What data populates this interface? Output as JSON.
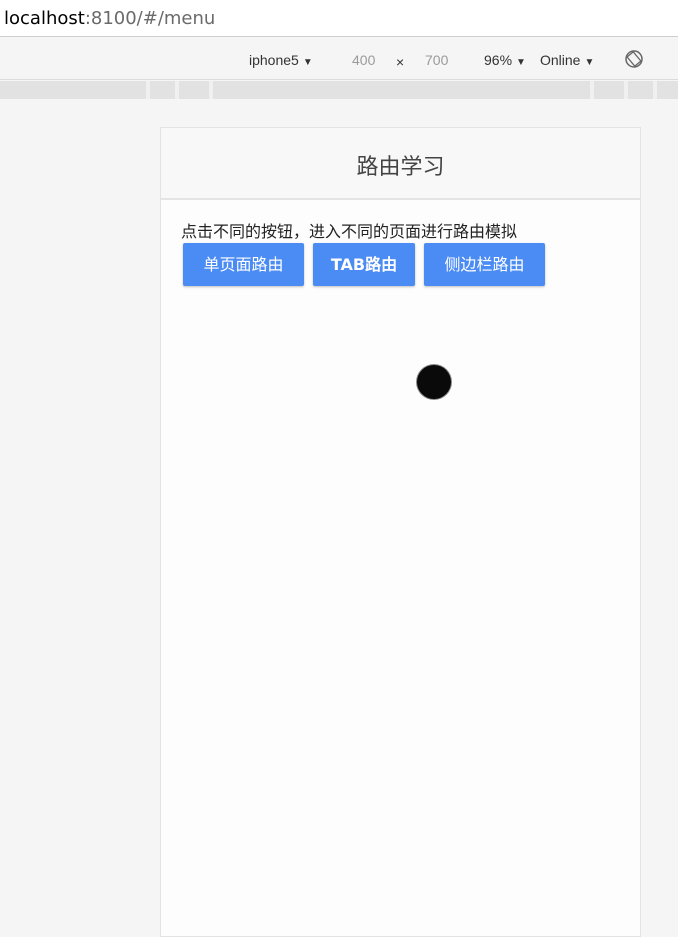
{
  "browser": {
    "url_host": "localhost",
    "url_rest": ":8100/#/menu"
  },
  "devtools": {
    "device": "iphone5",
    "width": "400",
    "times": "×",
    "height": "700",
    "zoom": "96%",
    "network": "Online",
    "dropdown_glyph": "▼"
  },
  "app": {
    "title": "路由学习",
    "description": "点击不同的按钮，进入不同的页面进行路由模拟",
    "buttons": [
      {
        "label": "单页面路由"
      },
      {
        "label": "TAB路由"
      },
      {
        "label": "侧边栏路由"
      }
    ],
    "accent_color": "#4b8bf4"
  }
}
